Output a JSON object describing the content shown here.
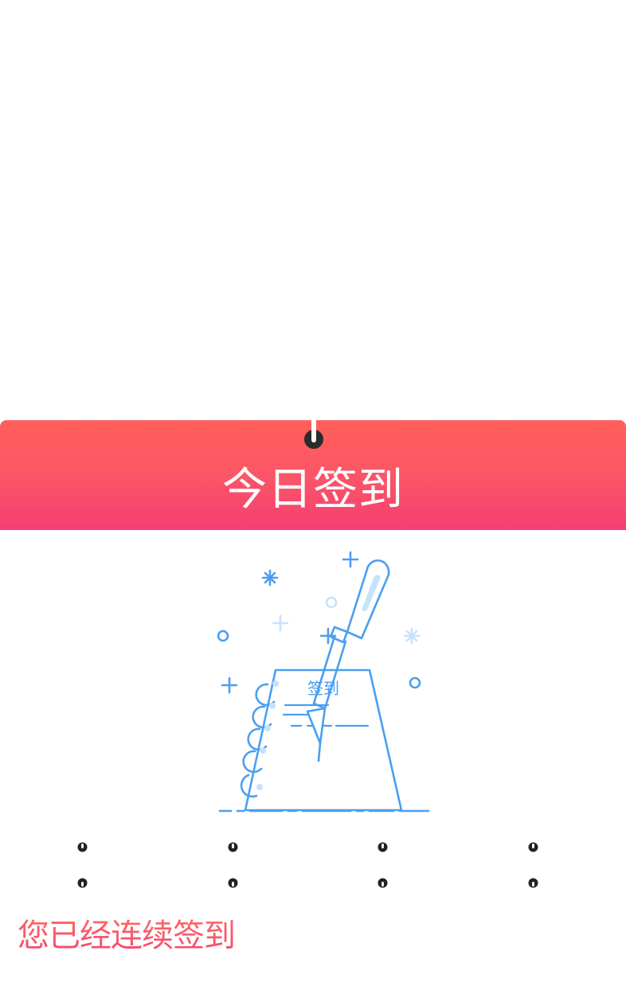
{
  "banner": {
    "title": "今日签到",
    "gradient_top": "#ff5f5a",
    "gradient_bottom": "#f43e72"
  },
  "illustration": {
    "icon": "notebook-pen-icon",
    "notebook_label": "签到",
    "stroke_color": "#4a9ff0",
    "accent_color": "#c7e2fb"
  },
  "streak": {
    "label": "您已经连续签到"
  }
}
